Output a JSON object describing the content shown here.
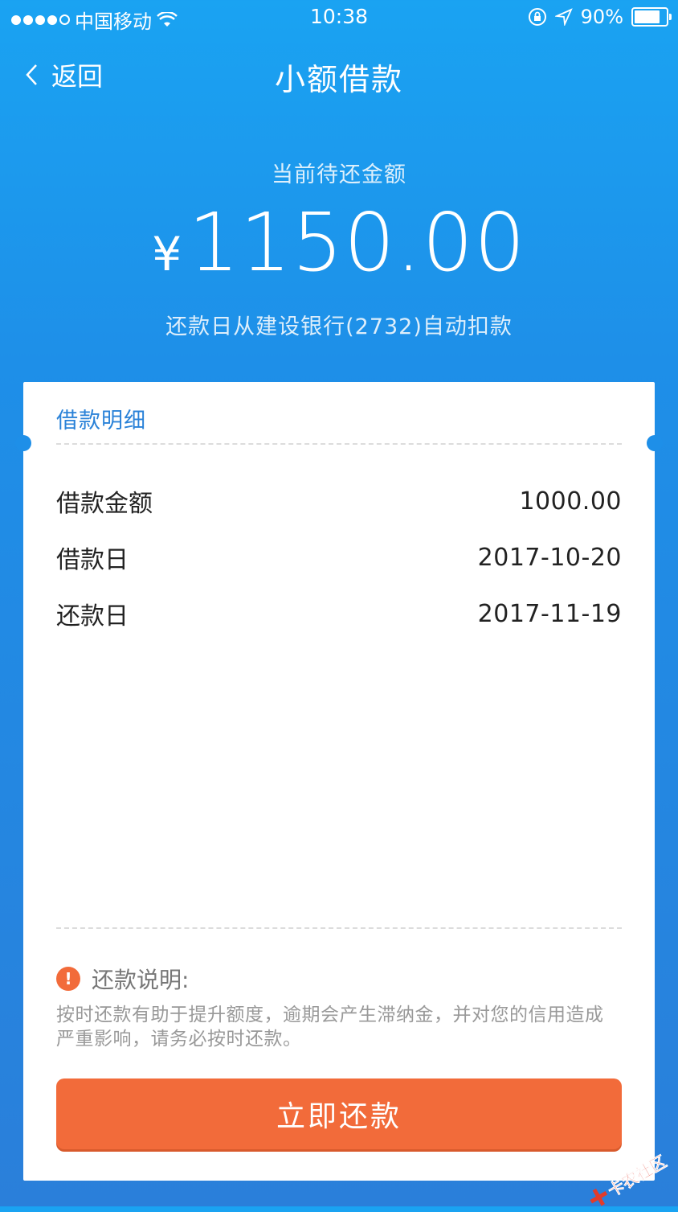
{
  "status_bar": {
    "carrier": "中国移动",
    "time": "10:38",
    "battery": "90%",
    "battery_level": 0.9
  },
  "nav": {
    "back_label": "返回",
    "title": "小额借款"
  },
  "hero": {
    "label": "当前待还金额",
    "currency": "¥",
    "amount": "1150.00",
    "note": "还款日从建设银行(2732)自动扣款"
  },
  "card": {
    "title": "借款明细",
    "rows": [
      {
        "label": "借款金额",
        "value": "1000.00"
      },
      {
        "label": "借款日",
        "value": "2017-10-20"
      },
      {
        "label": "还款日",
        "value": "2017-11-19"
      }
    ],
    "note_title": "还款说明:",
    "note_icon": "!",
    "note_text": "按时还款有助于提升额度，逾期会产生滞纳金，并对您的信用造成严重影响，请务必按时还款。",
    "pay_button": "立即还款"
  },
  "watermark": {
    "text": "卡农社区"
  },
  "colors": {
    "accent_blue": "#1e8fe8",
    "title_blue": "#2a82d8",
    "button_orange": "#f26b3a"
  }
}
